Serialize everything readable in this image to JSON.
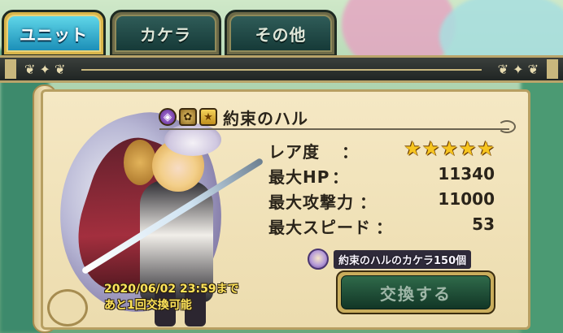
{
  "tabs": [
    {
      "label": "ユニット",
      "active": true
    },
    {
      "label": "カケラ",
      "active": false
    },
    {
      "label": "その他",
      "active": false
    }
  ],
  "unit": {
    "name": "約束のハル",
    "icons": [
      "element-orb-icon",
      "gear-badge-icon",
      "star-rank-icon"
    ],
    "rarity_label": "レア度",
    "rarity_colon": "：",
    "rarity_stars": 5,
    "stats": [
      {
        "label": "最大HP",
        "colon": "：",
        "value": "11340"
      },
      {
        "label": "最大攻撃力",
        "colon": "：",
        "value": "11000"
      },
      {
        "label": "最大スピード",
        "colon": "：",
        "value": "53"
      }
    ]
  },
  "fragment": {
    "text": "約束のハルのカケラ150個",
    "icon": "fragment-portrait-icon"
  },
  "deadline": {
    "line1": "2020/06/02 23:59まで",
    "line2": "あと1回交換可能"
  },
  "exchange_button": {
    "label": "交換する",
    "enabled": false
  },
  "colors": {
    "accent_gold": "#d9b54a",
    "active_tab": "#1c8fb8",
    "deadline_text": "#ffe45a",
    "star": "#f7c51f"
  }
}
